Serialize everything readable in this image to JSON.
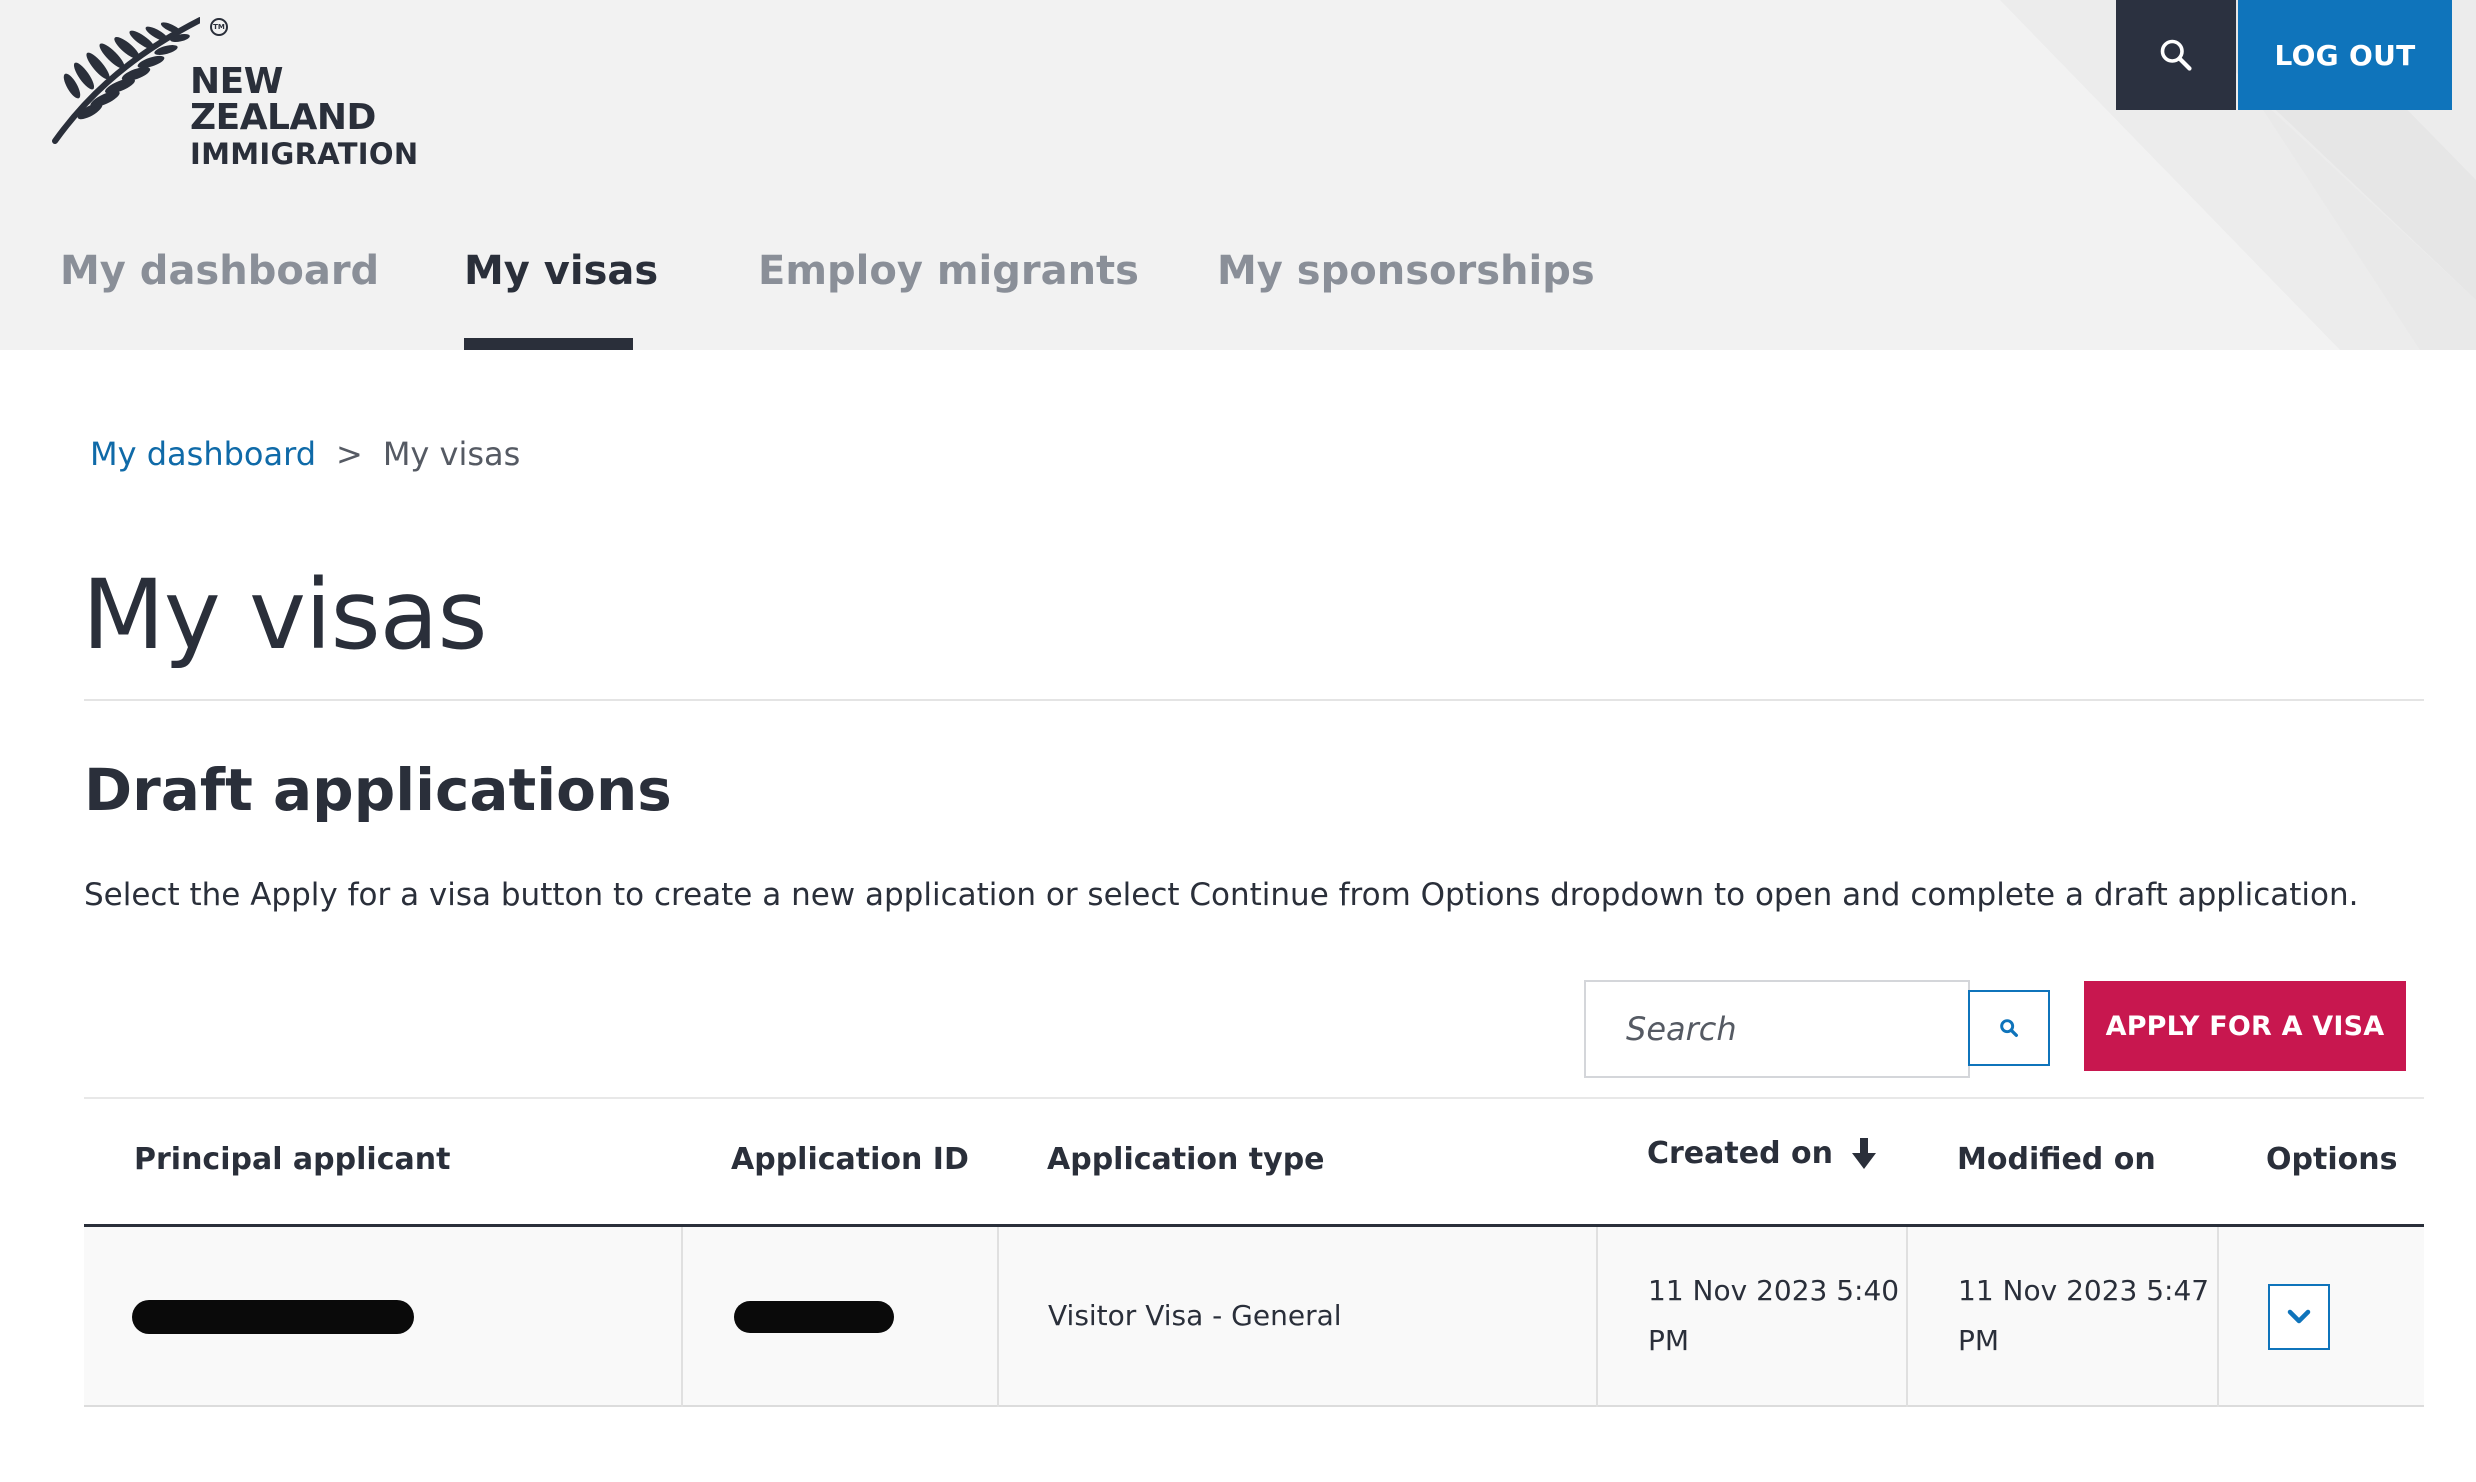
{
  "brand": {
    "line1": "NEW ZEALAND",
    "line2": "IMMIGRATION",
    "trademark": "TM"
  },
  "header": {
    "search_icon": "search-icon",
    "logout_label": "LOG OUT"
  },
  "nav": {
    "tabs": [
      {
        "label": "My dashboard",
        "active": false
      },
      {
        "label": "My visas",
        "active": true
      },
      {
        "label": "Employ migrants",
        "active": false
      },
      {
        "label": "My sponsorships",
        "active": false
      }
    ]
  },
  "breadcrumb": {
    "link": "My dashboard",
    "separator": ">",
    "current": "My visas"
  },
  "page": {
    "title": "My visas"
  },
  "drafts": {
    "title": "Draft applications",
    "description": "Select the Apply for a visa button to create a new application or select Continue from Options dropdown to open and complete a draft application.",
    "search_placeholder": "Search",
    "apply_label": "APPLY FOR A VISA",
    "columns": [
      "Principal applicant",
      "Application ID",
      "Application type",
      "Created on",
      "Modified on",
      "Options"
    ],
    "sorted_column": "Created on",
    "sort_direction": "descending",
    "rows": [
      {
        "principal_applicant": "[redacted]",
        "application_id": "[redacted]",
        "application_type": "Visitor Visa - General",
        "created_on": [
          "11 Nov 2023 5:40",
          "PM"
        ],
        "modified_on": [
          "11 Nov 2023 5:47",
          "PM"
        ]
      }
    ]
  },
  "colors": {
    "header_bg": "#f2f2f2",
    "dark": "#2b3140",
    "primary_blue": "#0f74bb",
    "apply_red": "#c8174f",
    "link_blue": "#0f6aa8"
  }
}
